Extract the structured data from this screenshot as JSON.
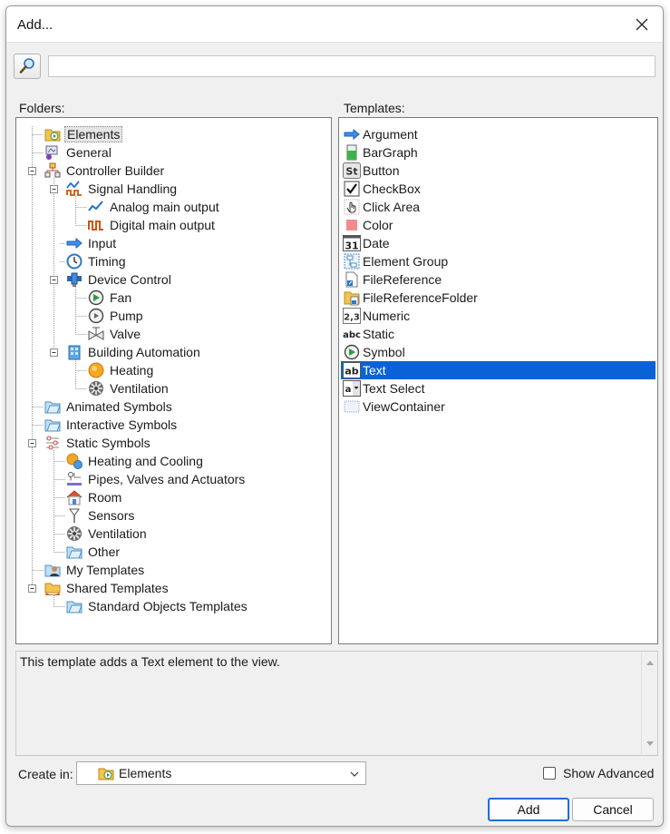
{
  "window": {
    "title": "Add..."
  },
  "search": {
    "placeholder": "",
    "value": ""
  },
  "folders": {
    "label": "Folders:",
    "items": [
      {
        "label": "Elements",
        "icon": "folder-elements-icon"
      },
      {
        "label": "General",
        "icon": "general-icon"
      },
      {
        "label": "Controller Builder",
        "icon": "controller-builder-icon"
      },
      {
        "label": "Signal Handling",
        "icon": "signal-handling-icon"
      },
      {
        "label": "Analog main output",
        "icon": "analog-wave-icon"
      },
      {
        "label": "Digital main output",
        "icon": "digital-wave-icon"
      },
      {
        "label": "Input",
        "icon": "input-arrow-icon"
      },
      {
        "label": "Timing",
        "icon": "clock-icon"
      },
      {
        "label": "Device Control",
        "icon": "device-control-icon"
      },
      {
        "label": "Fan",
        "icon": "fan-play-icon"
      },
      {
        "label": "Pump",
        "icon": "pump-icon"
      },
      {
        "label": "Valve",
        "icon": "valve-icon"
      },
      {
        "label": "Building Automation",
        "icon": "building-icon"
      },
      {
        "label": "Heating",
        "icon": "heating-icon"
      },
      {
        "label": "Ventilation",
        "icon": "ventilation-icon"
      },
      {
        "label": "Animated Symbols",
        "icon": "folder-icon"
      },
      {
        "label": "Interactive Symbols",
        "icon": "folder-icon"
      },
      {
        "label": "Static Symbols",
        "icon": "static-symbols-icon"
      },
      {
        "label": "Heating and Cooling",
        "icon": "heating-cooling-icon"
      },
      {
        "label": "Pipes, Valves and Actuators",
        "icon": "pipes-icon"
      },
      {
        "label": "Room",
        "icon": "room-icon"
      },
      {
        "label": "Sensors",
        "icon": "sensor-icon"
      },
      {
        "label": "Ventilation",
        "icon": "ventilation-icon"
      },
      {
        "label": "Other",
        "icon": "folder-icon"
      },
      {
        "label": "My Templates",
        "icon": "my-templates-icon"
      },
      {
        "label": "Shared Templates",
        "icon": "shared-templates-icon"
      },
      {
        "label": "Standard Objects Templates",
        "icon": "folder-icon"
      }
    ]
  },
  "templates": {
    "label": "Templates:",
    "items": [
      {
        "label": "Argument",
        "icon": "arrow-right-icon"
      },
      {
        "label": "BarGraph",
        "icon": "bargraph-icon"
      },
      {
        "label": "Button",
        "icon": "button-st-icon"
      },
      {
        "label": "CheckBox",
        "icon": "checkbox-icon"
      },
      {
        "label": "Click Area",
        "icon": "hand-icon"
      },
      {
        "label": "Color",
        "icon": "color-square-icon"
      },
      {
        "label": "Date",
        "icon": "calendar-icon"
      },
      {
        "label": "Element Group",
        "icon": "element-group-icon"
      },
      {
        "label": "FileReference",
        "icon": "file-reference-icon"
      },
      {
        "label": "FileReferenceFolder",
        "icon": "file-reference-folder-icon"
      },
      {
        "label": "Numeric",
        "icon": "numeric-icon"
      },
      {
        "label": "Static",
        "icon": "static-abc-icon"
      },
      {
        "label": "Symbol",
        "icon": "symbol-play-icon"
      },
      {
        "label": "Text",
        "icon": "text-ab-icon"
      },
      {
        "label": "Text Select",
        "icon": "text-select-icon"
      },
      {
        "label": "ViewContainer",
        "icon": "view-container-icon"
      }
    ],
    "selected": "Text"
  },
  "description": {
    "text": "This template adds a Text element to the view."
  },
  "create_in": {
    "label": "Create in:",
    "value": "Elements"
  },
  "show_advanced": {
    "label": "Show Advanced",
    "checked": false
  },
  "buttons": {
    "add": "Add",
    "cancel": "Cancel"
  },
  "colors": {
    "selection": "#0a63d6",
    "dialog_bg": "#f0f0f0",
    "accent_border": "#1f6fd6"
  }
}
